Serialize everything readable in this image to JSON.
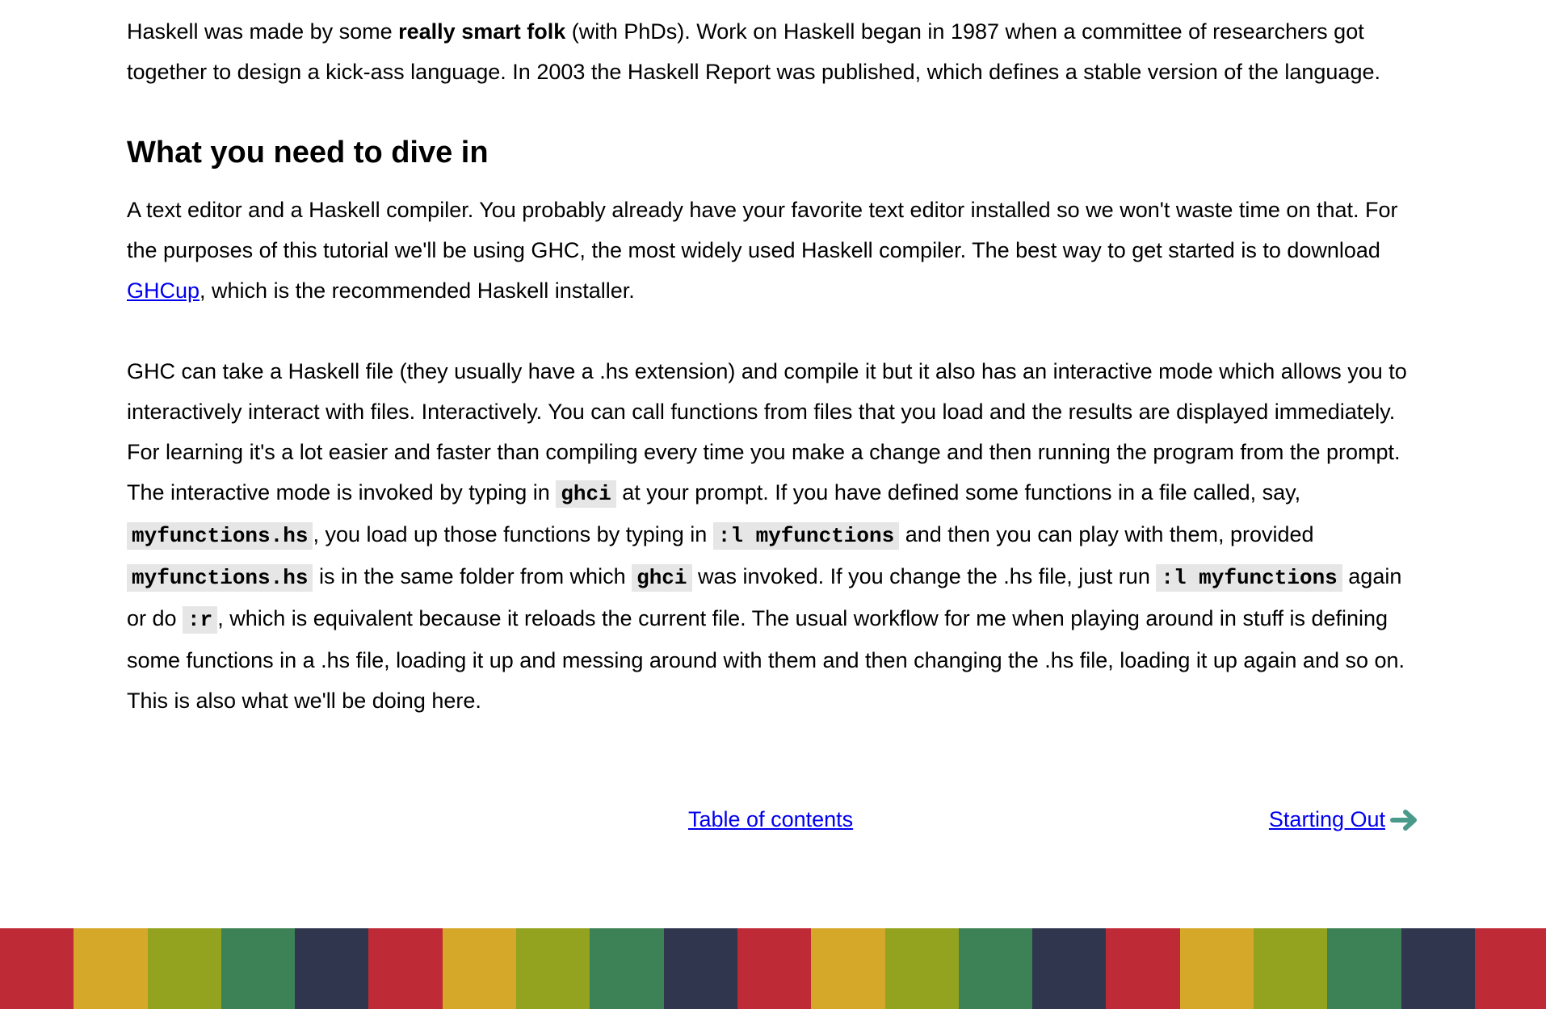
{
  "intro": {
    "p1_a": "Haskell was made by some ",
    "p1_bold": "really smart folk",
    "p1_b": " (with PhDs). Work on Haskell began in 1987 when a committee of researchers got together to design a kick-ass language. In 2003 the Haskell Report was published, which defines a stable version of the language."
  },
  "section": {
    "heading": "What you need to dive in",
    "p2_a": "A text editor and a Haskell compiler. You probably already have your favorite text editor installed so we won't waste time on that. For the purposes of this tutorial we'll be using GHC, the most widely used Haskell compiler. The best way to get started is to download ",
    "p2_link": "GHCup",
    "p2_b": ", which is the recommended Haskell installer.",
    "p3": {
      "t1": "GHC can take a Haskell file (they usually have a .hs extension) and compile it but it also has an interactive mode which allows you to interactively interact with files. Interactively. You can call functions from files that you load and the results are displayed immediately. For learning it's a lot easier and faster than compiling every time you make a change and then running the program from the prompt. The interactive mode is invoked by typing in ",
      "c1": "ghci",
      "t2": " at your prompt. If you have defined some functions in a file called, say, ",
      "c2": "myfunctions.hs",
      "t3": ", you load up those functions by typing in ",
      "c3": ":l myfunctions",
      "t4": " and then you can play with them, provided ",
      "c4": "myfunctions.hs",
      "t5": " is in the same folder from which ",
      "c5": "ghci",
      "t6": " was invoked. If you change the .hs file, just run ",
      "c6": ":l myfunctions",
      "t7": " again or do ",
      "c7": ":r",
      "t8": ", which is equivalent because it reloads the current file. The usual workflow for me when playing around in stuff is defining some functions in a .hs file, loading it up and messing around with them and then changing the .hs file, loading it up again and so on. This is also what we'll be doing here."
    }
  },
  "nav": {
    "toc_label": "Table of contents",
    "next_label": "Starting Out",
    "next_icon": "arrow-right-icon"
  },
  "colors": {
    "link": "#0000ee",
    "code_bg": "#e6e6e6",
    "arrow": "#4a9a8c",
    "stripe": [
      "#be2a35",
      "#d6a829",
      "#93a31f",
      "#3d8157",
      "#31364f"
    ]
  }
}
